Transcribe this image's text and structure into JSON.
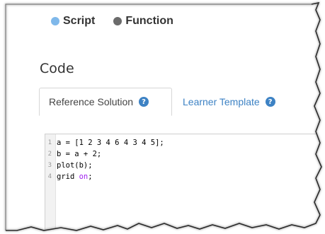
{
  "type_options": [
    {
      "label": "Script",
      "selected": true
    },
    {
      "label": "Function",
      "selected": false
    }
  ],
  "section": {
    "title": "Code"
  },
  "tabs": [
    {
      "label": "Reference Solution",
      "active": true,
      "help_icon": "question-circle-icon"
    },
    {
      "label": "Learner Template",
      "active": false,
      "help_icon": "question-circle-icon"
    }
  ],
  "editor": {
    "lines": [
      {
        "number": "1",
        "code": "a = [1 2 3 4 6 4 3 4 5];"
      },
      {
        "number": "2",
        "code": "b = a + 2;"
      },
      {
        "number": "3",
        "code": "plot(b);"
      },
      {
        "number": "4",
        "code_before": "grid ",
        "keyword": "on",
        "code_after": ";"
      }
    ]
  },
  "colors": {
    "selected_radio": "#7fb8ea",
    "unselected_radio": "#6b6b6b",
    "link_blue": "#3d82c4",
    "keyword_purple": "#a020f0"
  }
}
